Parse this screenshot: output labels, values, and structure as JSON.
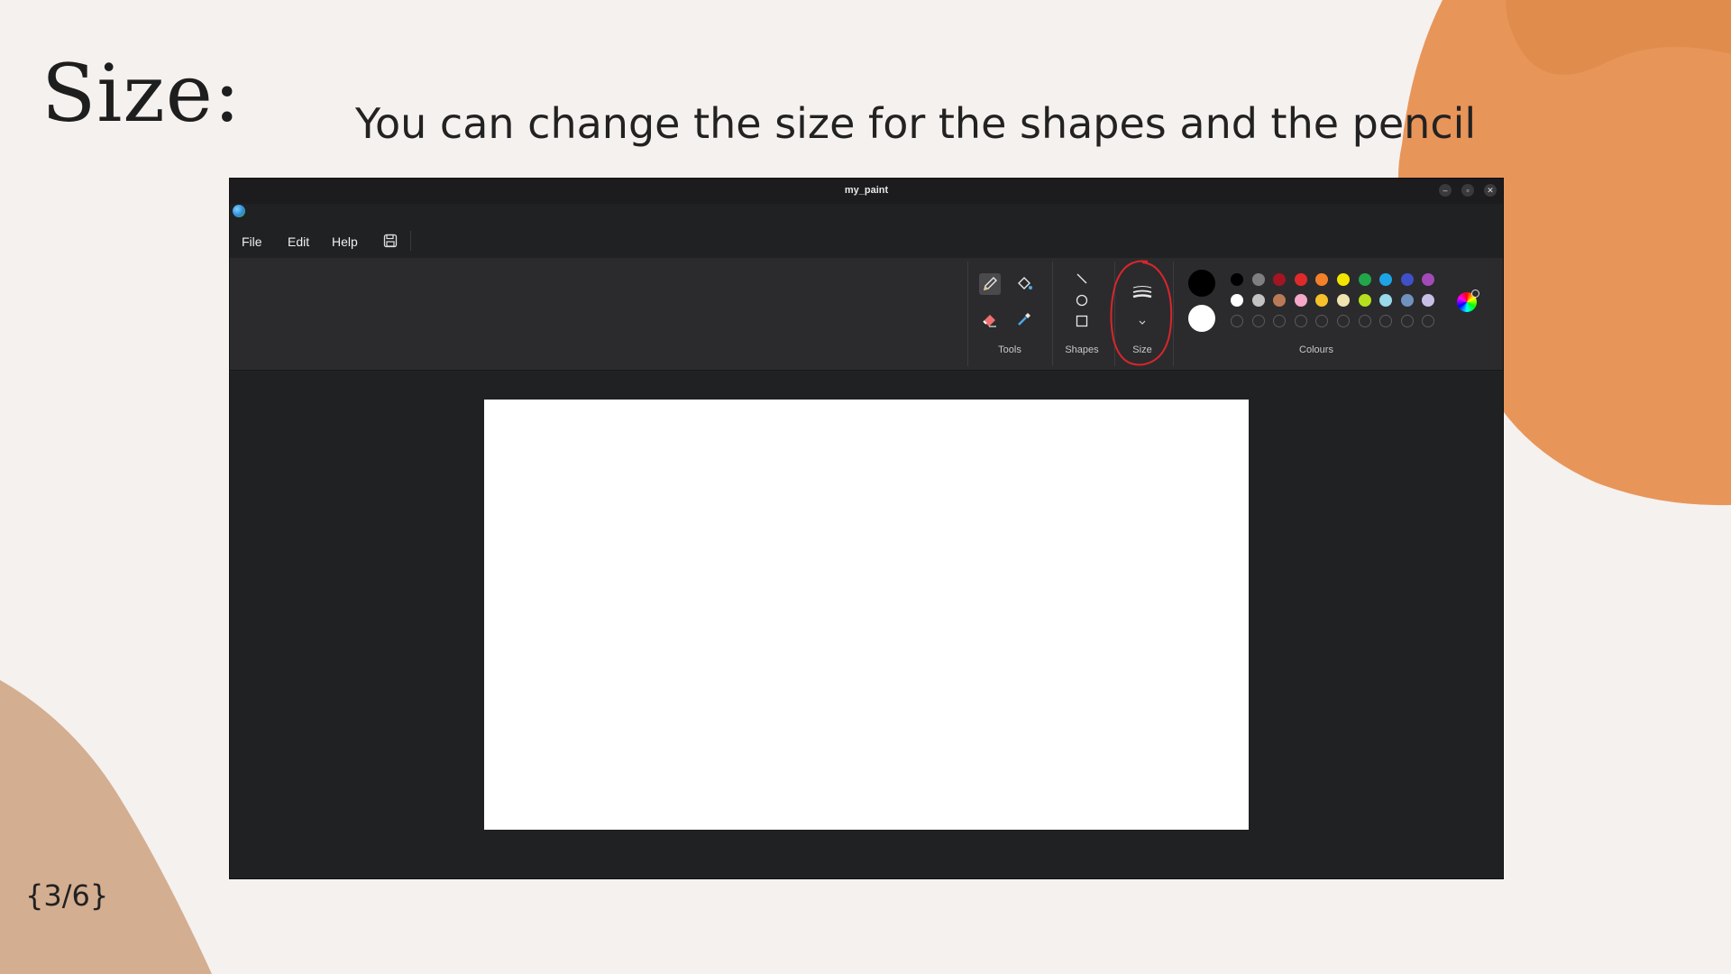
{
  "slide": {
    "title": "Size:",
    "subtitle": "You can change the size for the shapes and the pencil",
    "page": "{3/6}"
  },
  "colors": {
    "background": "#f5f1ee",
    "blob_orange": "#e8955a",
    "blob_orange_dark": "#e08c4c",
    "blob_tan": "#d4ae91",
    "annotation_circle": "#d8262c"
  },
  "window": {
    "title": "my_paint",
    "controls": [
      "minimize-icon",
      "maximize-icon",
      "close-icon"
    ],
    "menu": {
      "file": "File",
      "edit": "Edit",
      "help": "Help",
      "save_icon": "save-icon"
    },
    "ribbon": {
      "tools_label": "Tools",
      "tools": [
        "pencil-icon",
        "fill-bucket-icon",
        "eraser-icon",
        "color-picker-icon"
      ],
      "shapes_label": "Shapes",
      "shapes": [
        "line-icon",
        "ellipse-icon",
        "rectangle-icon"
      ],
      "size_label": "Size",
      "size_icon": "stroke-size-icon",
      "colours_label": "Colours",
      "primary_color": "#000000",
      "secondary_color": "#ffffff",
      "palette_row1": [
        "#000000",
        "#7f7f7f",
        "#a31522",
        "#e02a2a",
        "#f5802a",
        "#f2e600",
        "#22a64a",
        "#1da4e6",
        "#4050c8",
        "#a24ab8"
      ],
      "palette_row2": [
        "#ffffff",
        "#c3c3c3",
        "#b97a57",
        "#f5a8c8",
        "#f6c12a",
        "#efe4b0",
        "#b6e01e",
        "#99d9ea",
        "#7092be",
        "#c8bfe7"
      ],
      "empty_slots": 10,
      "edit_colours_icon": "color-wheel-icon"
    }
  }
}
